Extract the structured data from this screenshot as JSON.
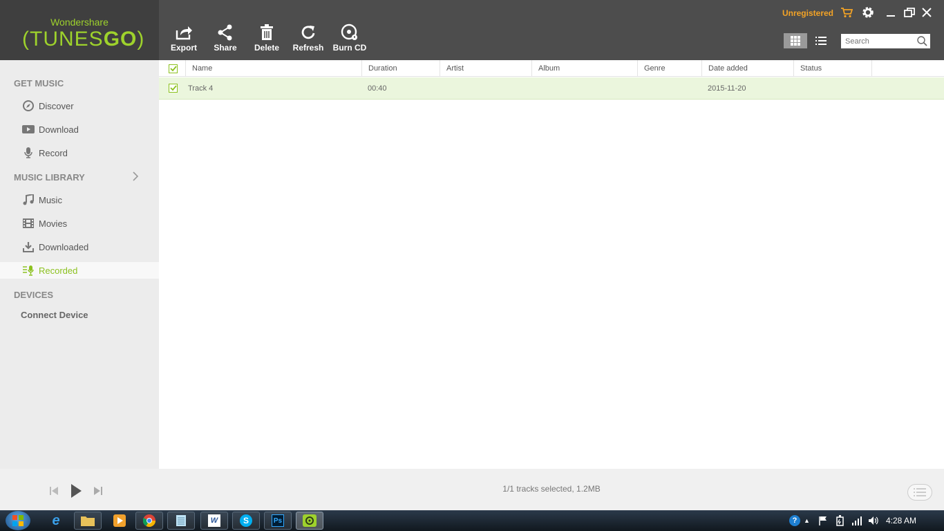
{
  "app": {
    "brand_top": "Wondershare",
    "brand_main_light": "TUNES",
    "brand_main_bold": "GO",
    "accent_color": "#9ed22c"
  },
  "toolbar": {
    "export": "Export",
    "share": "Share",
    "delete": "Delete",
    "refresh": "Refresh",
    "burn_cd": "Burn CD"
  },
  "header": {
    "unregistered": "Unregistered",
    "search_placeholder": "Search"
  },
  "sidebar": {
    "get_music_title": "GET MUSIC",
    "discover": "Discover",
    "download": "Download",
    "record": "Record",
    "music_library_title": "MUSIC LIBRARY",
    "music": "Music",
    "movies": "Movies",
    "downloaded": "Downloaded",
    "recorded": "Recorded",
    "devices_title": "DEVICES",
    "connect_device": "Connect Device"
  },
  "table": {
    "columns": [
      "Name",
      "Duration",
      "Artist",
      "Album",
      "Genre",
      "Date added",
      "Status"
    ],
    "rows": [
      {
        "name": "Track 4",
        "duration": "00:40",
        "artist": "",
        "album": "",
        "genre": "",
        "date_added": "2015-11-20",
        "status": ""
      }
    ]
  },
  "footer": {
    "status": "1/1 tracks selected, 1.2MB"
  },
  "taskbar": {
    "clock": "4:28 AM"
  }
}
